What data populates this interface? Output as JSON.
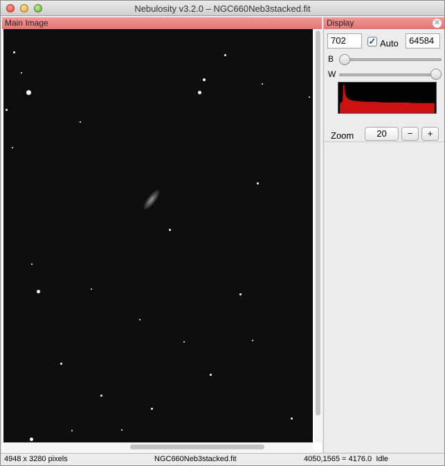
{
  "window": {
    "title": "Nebulosity v3.2.0 – NGC660Neb3stacked.fit"
  },
  "main_panel": {
    "header": "Main Image"
  },
  "display_panel": {
    "header": "Display",
    "black_value": "702",
    "auto_label": "Auto",
    "auto_checked": true,
    "white_value": "64584",
    "b_label": "B",
    "w_label": "W",
    "b_slider_level": 0.0,
    "w_slider_level": 1.0,
    "zoom_label": "Zoom",
    "zoom_value": "20",
    "minus_label": "−",
    "plus_label": "+",
    "histogram_color": "#cc1111"
  },
  "status": {
    "dimensions": "4948 x 3280 pixels",
    "filename": "NGC660Neb3stacked.fit",
    "cursor_readout": "4050,1565 = 4176.0",
    "state": "Idle"
  },
  "colors": {
    "panel_header": "#e57474",
    "image_background": "#0d0d0d"
  }
}
